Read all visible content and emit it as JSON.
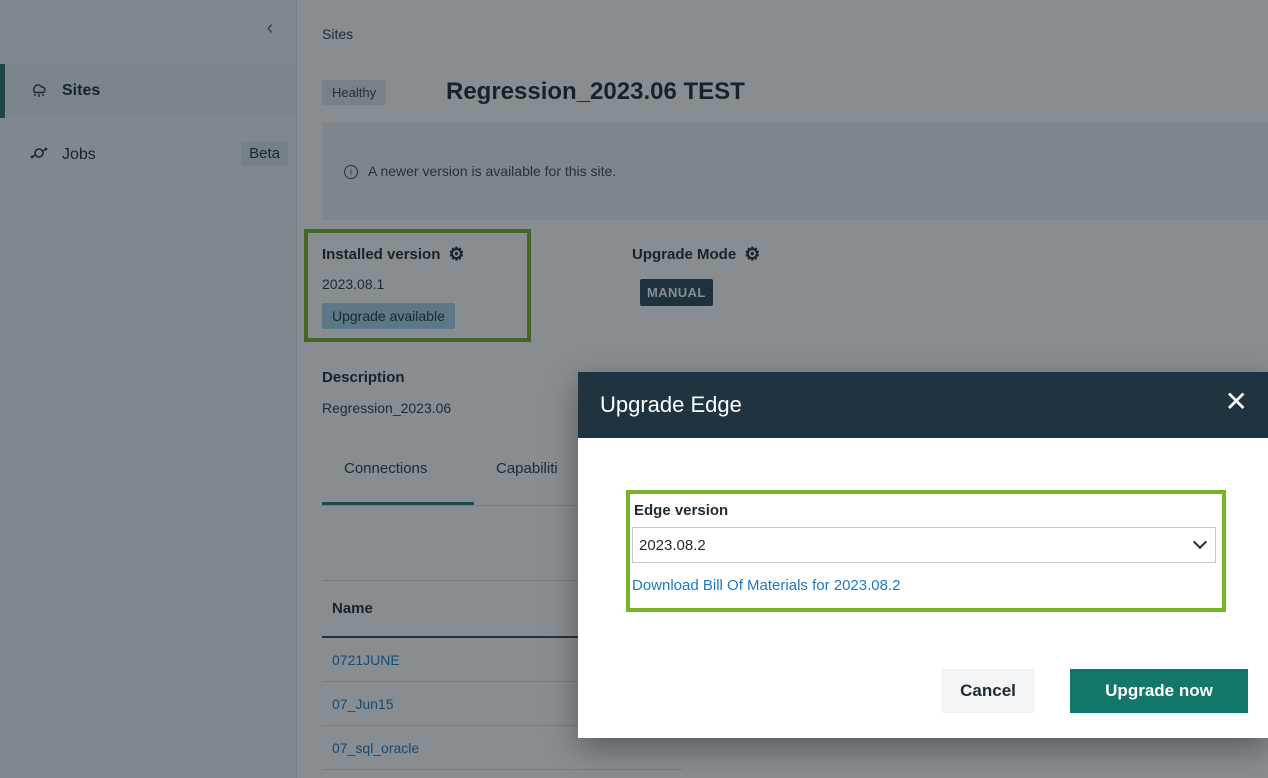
{
  "sidebar": {
    "collapse_glyph": "‹",
    "items": [
      {
        "label": "Sites",
        "icon": "sites-icon",
        "active": true
      },
      {
        "label": "Jobs",
        "icon": "jobs-icon",
        "badge": "Beta"
      }
    ]
  },
  "main": {
    "breadcrumb": "Sites",
    "health_badge": "Healthy",
    "site_title": "Regression_2023.06 TEST",
    "info_banner": "A newer version is available for this site.",
    "installed_version": {
      "label": "Installed version",
      "value": "2023.08.1",
      "status": "Upgrade available"
    },
    "upgrade_mode": {
      "label": "Upgrade Mode",
      "value": "MANUAL"
    },
    "description": {
      "label": "Description",
      "value": "Regression_2023.06"
    },
    "tabs": [
      {
        "label": "Connections",
        "active": true
      },
      {
        "label": "Capabiliti"
      }
    ],
    "table": {
      "header": "Name",
      "rows": [
        "0721JUNE",
        "07_Jun15",
        "07_sql_oracle"
      ]
    }
  },
  "modal": {
    "title": "Upgrade Edge",
    "close_glyph": "✕",
    "edge_version_label": "Edge version",
    "edge_version_value": "2023.08.2",
    "bom_link": "Download Bill Of Materials for 2023.08.2",
    "cancel_label": "Cancel",
    "upgrade_label": "Upgrade now"
  },
  "colors": {
    "accent": "#13776a",
    "highlight_box": "#79b32a",
    "modal_header": "#1f3440",
    "link": "#1c7ac0"
  }
}
